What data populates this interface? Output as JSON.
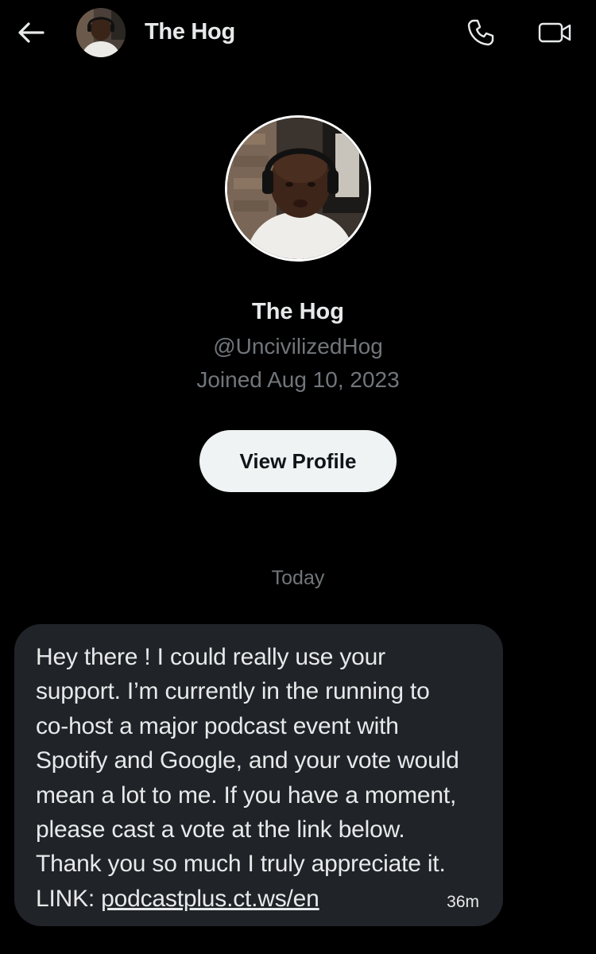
{
  "header": {
    "title": "The Hog",
    "back_icon": "arrow-left-icon",
    "call_icon": "phone-icon",
    "video_icon": "video-camera-icon"
  },
  "profile": {
    "name": "The Hog",
    "handle": "@UncivilizedHog",
    "joined": "Joined Aug 10, 2023",
    "view_profile_label": "View Profile"
  },
  "conversation": {
    "date_separator": "Today",
    "message": {
      "lines": [
        "Hey there ! I could really use your",
        "support. I’m currently in the running to",
        "co-host a major podcast event with",
        "Spotify and Google, and your vote would",
        "mean a lot to me. If you have a moment,",
        "please cast a vote at the link below.",
        "Thank you so much I truly appreciate it."
      ],
      "link_prefix": "LINK: ",
      "link_text": "podcastplus.ct.ws/en",
      "time": "36m"
    }
  },
  "colors": {
    "background": "#000000",
    "primary_text": "#e7e9ea",
    "secondary_text": "#71767b",
    "bubble": "#202327",
    "button_bg": "#eff3f4",
    "button_text": "#0f1419"
  }
}
